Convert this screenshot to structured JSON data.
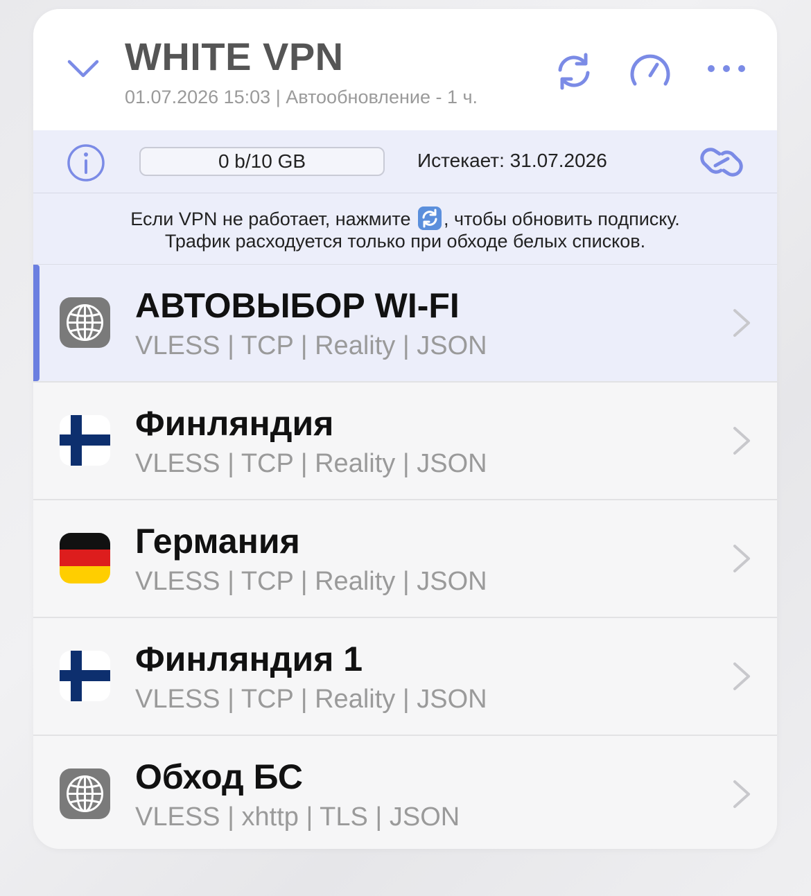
{
  "header": {
    "title": "WHITE VPN",
    "subtitle": "01.07.2026 15:03 | Автообновление - 1 ч.",
    "icons": [
      "chevron-down-icon",
      "refresh-icon",
      "speedometer-icon",
      "more-icon"
    ]
  },
  "info_bar": {
    "traffic": "0 b/10 GB",
    "expires": "Истекает: 31.07.2026",
    "icons": [
      "info-icon",
      "link-icon"
    ]
  },
  "notice": {
    "line1_before": "Если VPN не работает, нажмите",
    "line1_after": ", чтобы обновить подписку.",
    "line2": "Трафик расходуется только при обходе белых списков."
  },
  "colors": {
    "accent": "#6b7fe0",
    "icon_blue": "#7b8be6",
    "highlight_bg": "#eceefa"
  },
  "servers": [
    {
      "name": "АВТОВЫБОР WI-FI",
      "protocol": "VLESS | TCP | Reality | JSON",
      "icon": "globe-icon",
      "selected": true
    },
    {
      "name": "Финляндия",
      "protocol": "VLESS | TCP | Reality | JSON",
      "icon": "finland-flag-icon",
      "selected": false
    },
    {
      "name": "Германия",
      "protocol": "VLESS | TCP | Reality | JSON",
      "icon": "germany-flag-icon",
      "selected": false
    },
    {
      "name": "Финляндия 1",
      "protocol": "VLESS | TCP | Reality | JSON",
      "icon": "finland-flag-icon",
      "selected": false
    },
    {
      "name": "Обход БС",
      "protocol": "VLESS | xhttp | TLS | JSON",
      "icon": "globe-icon",
      "selected": false
    }
  ]
}
